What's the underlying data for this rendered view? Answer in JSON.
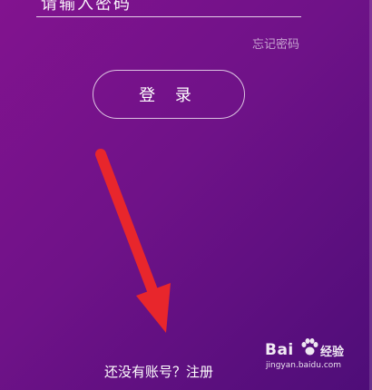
{
  "password": {
    "placeholder": "请输入密码"
  },
  "forgot_password": "忘记密码",
  "login_button": "登 录",
  "register_prompt": "还没有账号？注册",
  "watermark": {
    "logo": "Bai",
    "logo_suffix": "经验",
    "url": "jingyan.baidu.com"
  },
  "annotation": {
    "arrow_color": "#e8262c"
  },
  "colors": {
    "background_start": "#82138f",
    "background_end": "#4e0d78",
    "text": "#ffffff"
  }
}
